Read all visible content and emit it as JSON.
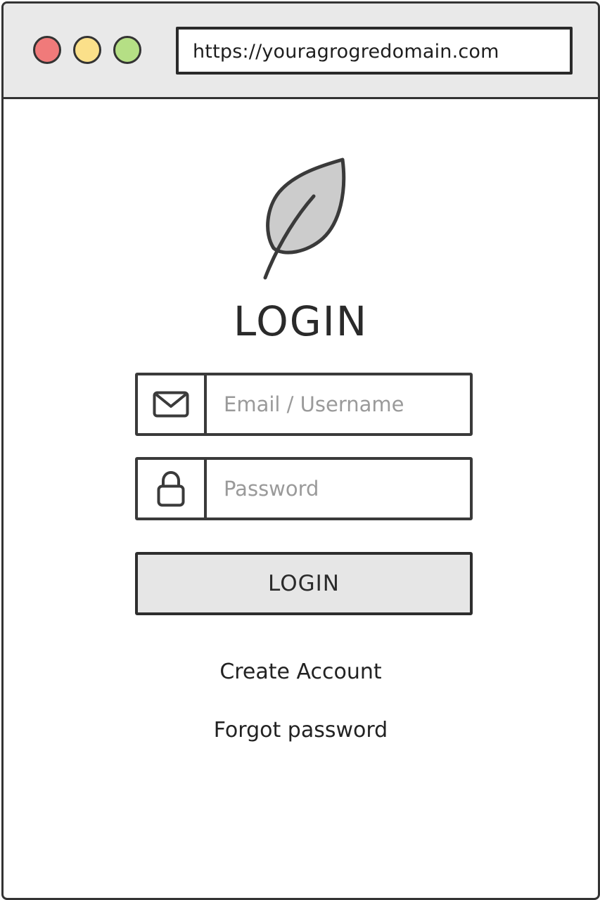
{
  "browser": {
    "url": "https://youragrogredomain.com",
    "controls": [
      {
        "name": "close-window-button",
        "color": "#f07a7a"
      },
      {
        "name": "minimize-window-button",
        "color": "#fbe08a"
      },
      {
        "name": "maximize-window-button",
        "color": "#b5df85"
      }
    ]
  },
  "logo": {
    "icon": "leaf-icon",
    "fill_color": "#cccccc"
  },
  "login_form": {
    "title": "LOGIN",
    "email": {
      "icon": "envelope-icon",
      "placeholder": "Email / Username",
      "value": ""
    },
    "password": {
      "icon": "lock-icon",
      "placeholder": "Password",
      "value": ""
    },
    "submit_label": "LOGIN",
    "button_color": "#e6e6e6"
  },
  "links": {
    "create_account": "Create Account",
    "forgot_password": "Forgot password"
  }
}
